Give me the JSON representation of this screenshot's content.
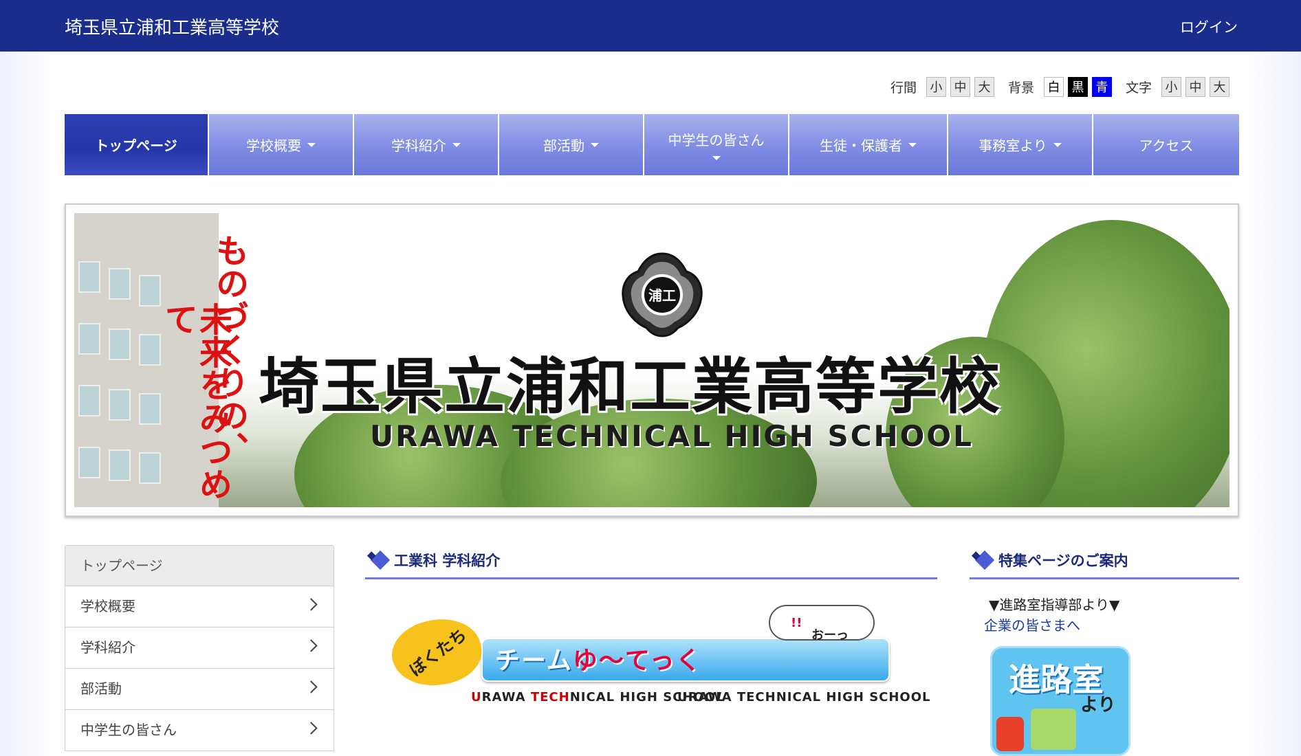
{
  "header": {
    "title": "埼玉県立浦和工業高等学校",
    "login_label": "ログイン"
  },
  "accessibility": {
    "line_spacing": {
      "label": "行間",
      "options": [
        "小",
        "中",
        "大"
      ]
    },
    "background": {
      "label": "背景",
      "options": [
        "白",
        "黒",
        "青"
      ]
    },
    "text_size": {
      "label": "文字",
      "options": [
        "小",
        "中",
        "大"
      ]
    }
  },
  "nav": {
    "items": [
      {
        "label": "トップページ",
        "active": true
      },
      {
        "label": "学校概要"
      },
      {
        "label": "学科紹介"
      },
      {
        "label": "部活動"
      },
      {
        "label": "中学生の皆さん"
      },
      {
        "label": "生徒・保護者"
      },
      {
        "label": "事務室より"
      },
      {
        "label": "アクセス"
      }
    ]
  },
  "hero": {
    "tagline_1": "ものづくりの、",
    "tagline_2": "未来をみつめて",
    "title": "埼玉県立浦和工業高等学校",
    "subtitle": "URAWA TECHNICAL HIGH SCHOOL",
    "emblem_text": "浦工"
  },
  "sidebar": {
    "head": "トップページ",
    "items": [
      "学校概要",
      "学科紹介",
      "部活動",
      "中学生の皆さん"
    ]
  },
  "center": {
    "heading": "工業科 学科紹介",
    "banner": {
      "boku": "ぼくたち",
      "team_prefix": "チーム",
      "team_name": "ゆ〜てっく",
      "cloud_text": "おーっ",
      "cloud_mark": "!!",
      "caption_1_u": "U",
      "caption_1_a": "RAWA ",
      "caption_1_tech": "TECH",
      "caption_1_rest": "NICAL HIGH SCHOOL",
      "caption_2": "URAWA TECHNICAL HIGH SCHOOL"
    }
  },
  "right": {
    "heading": "特集ページのご案内",
    "notice": "▼進路室指導部より▼",
    "link": "企業の皆さまへ",
    "card_title": "進路室",
    "card_sub": "より"
  },
  "colors": {
    "header_bg": "#1a2d8c",
    "nav_active": "#2d3fb0",
    "nav_item": "#7f8ce3",
    "accent_line": "#6f7be0"
  }
}
